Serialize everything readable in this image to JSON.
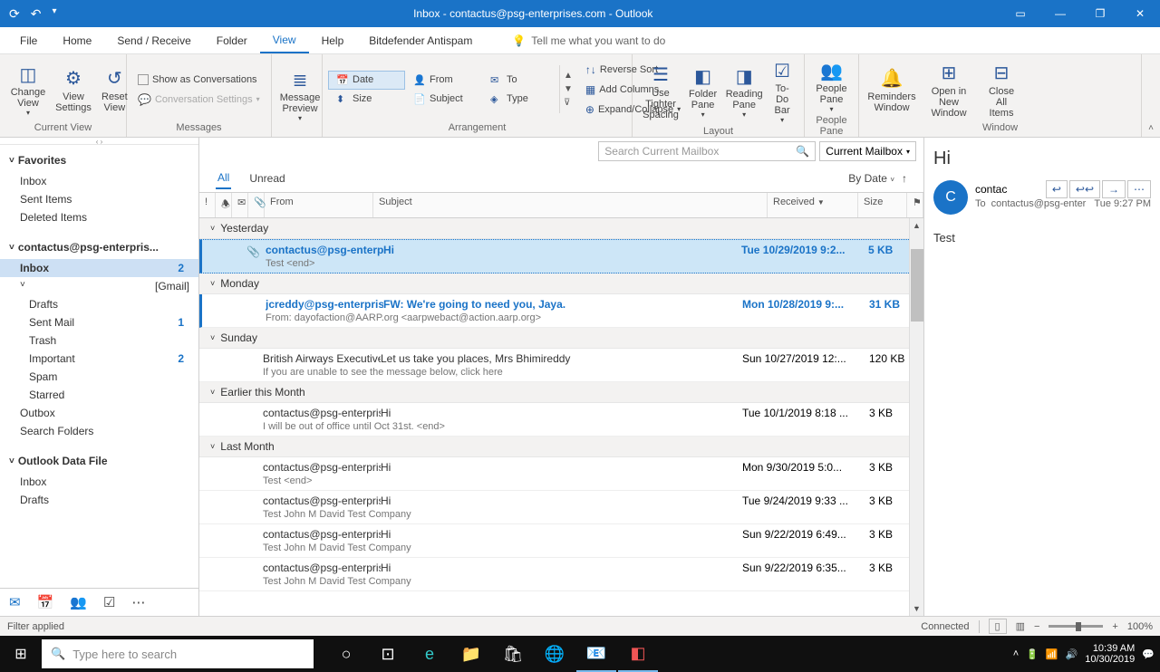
{
  "titlebar": {
    "title": "Inbox - contactus@psg-enterprises.com - Outlook"
  },
  "tabs": {
    "file": "File",
    "home": "Home",
    "sendreceive": "Send / Receive",
    "folder": "Folder",
    "view": "View",
    "help": "Help",
    "bitdefender": "Bitdefender Antispam",
    "tell": "Tell me what you want to do"
  },
  "ribbon": {
    "currentview": {
      "label": "Current View",
      "changeview": "Change View",
      "viewsettings": "View Settings",
      "resetview": "Reset View"
    },
    "messages": {
      "label": "Messages",
      "showconv": "Show as Conversations",
      "convsettings": "Conversation Settings",
      "msgpreview": "Message Preview"
    },
    "arrangement": {
      "label": "Arrangement",
      "date": "Date",
      "from": "From",
      "to": "To",
      "size": "Size",
      "subject": "Subject",
      "type": "Type",
      "reversesort": "Reverse Sort",
      "addcolumns": "Add Columns",
      "expand": "Expand/Collapse"
    },
    "layout": {
      "label": "Layout",
      "tighter": "Use Tighter Spacing",
      "folderpane": "Folder Pane",
      "readingpane": "Reading Pane",
      "todobar": "To-Do Bar"
    },
    "peoplepane": {
      "label": "People Pane",
      "btn": "People Pane"
    },
    "window": {
      "label": "Window",
      "reminders": "Reminders Window",
      "opennew": "Open in New Window",
      "closeall": "Close All Items"
    }
  },
  "nav": {
    "favorites": {
      "hdr": "Favorites",
      "inbox": "Inbox",
      "sent": "Sent Items",
      "deleted": "Deleted Items"
    },
    "account": {
      "hdr": "contactus@psg-enterpris...",
      "inbox": "Inbox",
      "inbox_cnt": "2",
      "gmail": "[Gmail]",
      "drafts": "Drafts",
      "sentmail": "Sent Mail",
      "sentmail_cnt": "1",
      "trash": "Trash",
      "important": "Important",
      "important_cnt": "2",
      "spam": "Spam",
      "starred": "Starred",
      "outbox": "Outbox",
      "searchfolders": "Search Folders"
    },
    "odf": {
      "hdr": "Outlook Data File",
      "inbox": "Inbox",
      "drafts": "Drafts"
    }
  },
  "list": {
    "search_ph": "Search Current Mailbox",
    "scope": "Current Mailbox",
    "tabs": {
      "all": "All",
      "unread": "Unread"
    },
    "sort": "By Date",
    "cols": {
      "from": "From",
      "subject": "Subject",
      "received": "Received",
      "size": "Size"
    },
    "groups": {
      "yesterday": "Yesterday",
      "monday": "Monday",
      "sunday": "Sunday",
      "earlier": "Earlier this Month",
      "lastmonth": "Last Month"
    },
    "m0": {
      "from": "contactus@psg-enterpris...",
      "subj": "Hi",
      "date": "Tue 10/29/2019 9:2...",
      "size": "5 KB",
      "preview": "Test <end>"
    },
    "m1": {
      "from": "jcreddy@psg-enterprises...",
      "subj": "FW: We're going to need you, Jaya.",
      "date": "Mon 10/28/2019 9:...",
      "size": "31 KB",
      "preview": "From: dayofaction@AARP.org <aarpwebact@action.aarp.org>"
    },
    "m2": {
      "from": "British Airways Executive ...",
      "subj": "Let us take you places, Mrs Bhimireddy",
      "date": "Sun 10/27/2019 12:...",
      "size": "120 KB",
      "preview": "If you are unable to see the message below, click here"
    },
    "m3": {
      "from": "contactus@psg-enterpris...",
      "subj": "Hi",
      "date": "Tue 10/1/2019 8:18 ...",
      "size": "3 KB",
      "preview": "I will be out of office until Oct 31st. <end>"
    },
    "m4": {
      "from": "contactus@psg-enterpris...",
      "subj": "Hi",
      "date": "Mon 9/30/2019 5:0...",
      "size": "3 KB",
      "preview": "Test <end>"
    },
    "m5": {
      "from": "contactus@psg-enterpris...",
      "subj": "Hi",
      "date": "Tue 9/24/2019 9:33 ...",
      "size": "3 KB",
      "preview": "Test  John M David  Test Company"
    },
    "m6": {
      "from": "contactus@psg-enterpris...",
      "subj": "Hi",
      "date": "Sun 9/22/2019 6:49...",
      "size": "3 KB",
      "preview": "Test  John M David  Test Company"
    },
    "m7": {
      "from": "contactus@psg-enterpris...",
      "subj": "Hi",
      "date": "Sun 9/22/2019 6:35...",
      "size": "3 KB",
      "preview": "Test  John M David  Test Company"
    }
  },
  "reading": {
    "subject": "Hi",
    "avatar": "C",
    "from": "contac",
    "to_lbl": "To",
    "to": "contactus@psg-enter",
    "time": "Tue 9:27 PM",
    "body": "Test"
  },
  "status": {
    "filter": "Filter applied",
    "connected": "Connected",
    "zoom": "100%"
  },
  "taskbar": {
    "search": "Type here to search",
    "time": "10:39 AM",
    "date": "10/30/2019"
  }
}
